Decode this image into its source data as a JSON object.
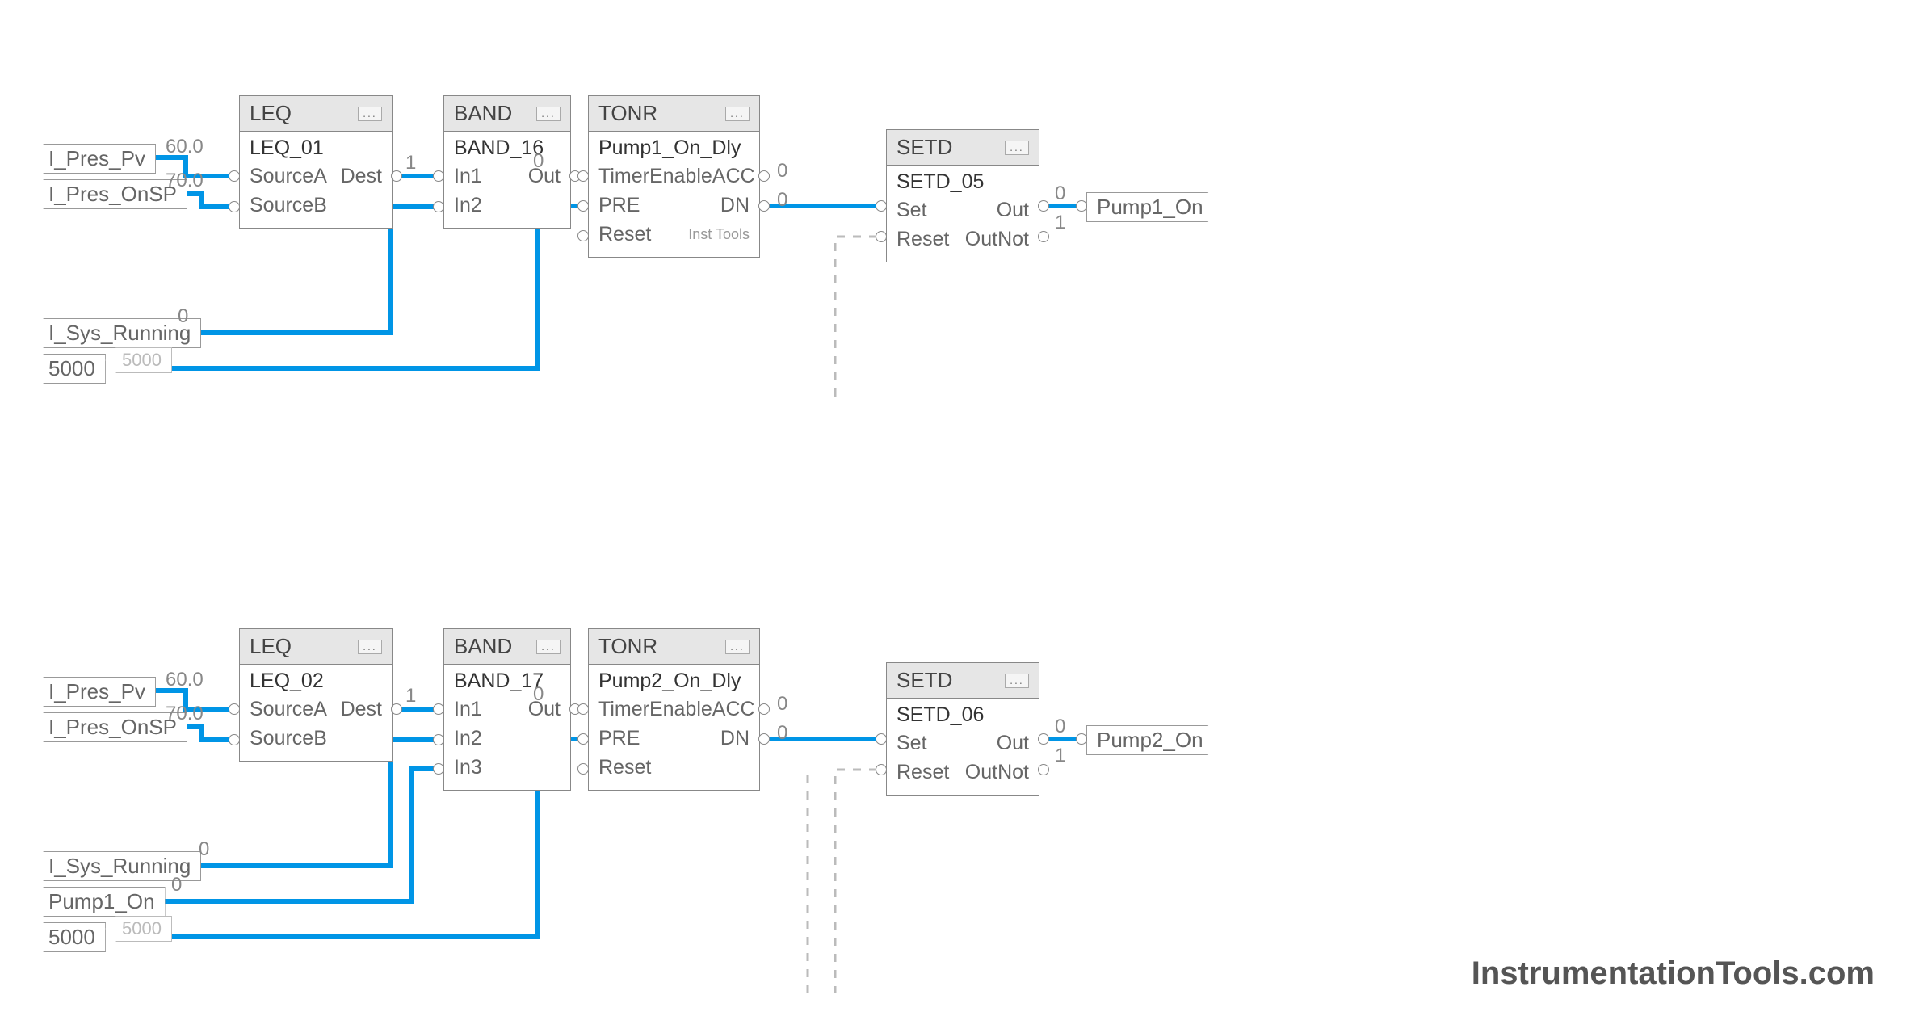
{
  "watermark": "InstrumentationTools.com",
  "network1": {
    "leq": {
      "type": "LEQ",
      "name": "LEQ_01",
      "inputs": {
        "a": "SourceA",
        "b": "SourceB"
      },
      "outputs": {
        "dest": "Dest"
      },
      "sourceA_tag": "I_Pres_Pv",
      "sourceB_tag": "I_Pres_OnSP",
      "sourceA_val": "60.0",
      "sourceB_val": "70.0",
      "dest_val": "1"
    },
    "band": {
      "type": "BAND",
      "name": "BAND_16",
      "inputs": {
        "in1": "In1",
        "in2": "In2"
      },
      "outputs": {
        "out": "Out"
      },
      "in2_tag": "I_Sys_Running",
      "in2_val": "0",
      "out_val": "0"
    },
    "tonr": {
      "type": "TONR",
      "name": "Pump1_On_Dly",
      "inputs": {
        "te": "TimerEnable",
        "pre": "PRE",
        "reset": "Reset"
      },
      "outputs": {
        "acc": "ACC",
        "dn": "DN"
      },
      "pre_const": "5000",
      "pre_ghost": "5000",
      "acc_val": "0",
      "dn_val": "0",
      "insttools": "Inst Tools"
    },
    "setd": {
      "type": "SETD",
      "name": "SETD_05",
      "inputs": {
        "set": "Set",
        "reset": "Reset"
      },
      "outputs": {
        "out": "Out",
        "outnot": "OutNot"
      },
      "out_tag": "Pump1_On",
      "out_val": "0",
      "outnot_val": "1"
    }
  },
  "network2": {
    "leq": {
      "type": "LEQ",
      "name": "LEQ_02",
      "inputs": {
        "a": "SourceA",
        "b": "SourceB"
      },
      "outputs": {
        "dest": "Dest"
      },
      "sourceA_tag": "I_Pres_Pv",
      "sourceB_tag": "I_Pres_OnSP",
      "sourceA_val": "60.0",
      "sourceB_val": "70.0",
      "dest_val": "1"
    },
    "band": {
      "type": "BAND",
      "name": "BAND_17",
      "inputs": {
        "in1": "In1",
        "in2": "In2",
        "in3": "In3"
      },
      "outputs": {
        "out": "Out"
      },
      "in2_tag": "I_Sys_Running",
      "in2_val": "0",
      "in3_tag": "Pump1_On",
      "in3_val": "0",
      "out_val": "0"
    },
    "tonr": {
      "type": "TONR",
      "name": "Pump2_On_Dly",
      "inputs": {
        "te": "TimerEnable",
        "pre": "PRE",
        "reset": "Reset"
      },
      "outputs": {
        "acc": "ACC",
        "dn": "DN"
      },
      "pre_const": "5000",
      "pre_ghost": "5000",
      "acc_val": "0",
      "dn_val": "0"
    },
    "setd": {
      "type": "SETD",
      "name": "SETD_06",
      "inputs": {
        "set": "Set",
        "reset": "Reset"
      },
      "outputs": {
        "out": "Out",
        "outnot": "OutNot"
      },
      "out_tag": "Pump2_On",
      "out_val": "0",
      "outnot_val": "1"
    }
  },
  "opts_glyph": "..."
}
